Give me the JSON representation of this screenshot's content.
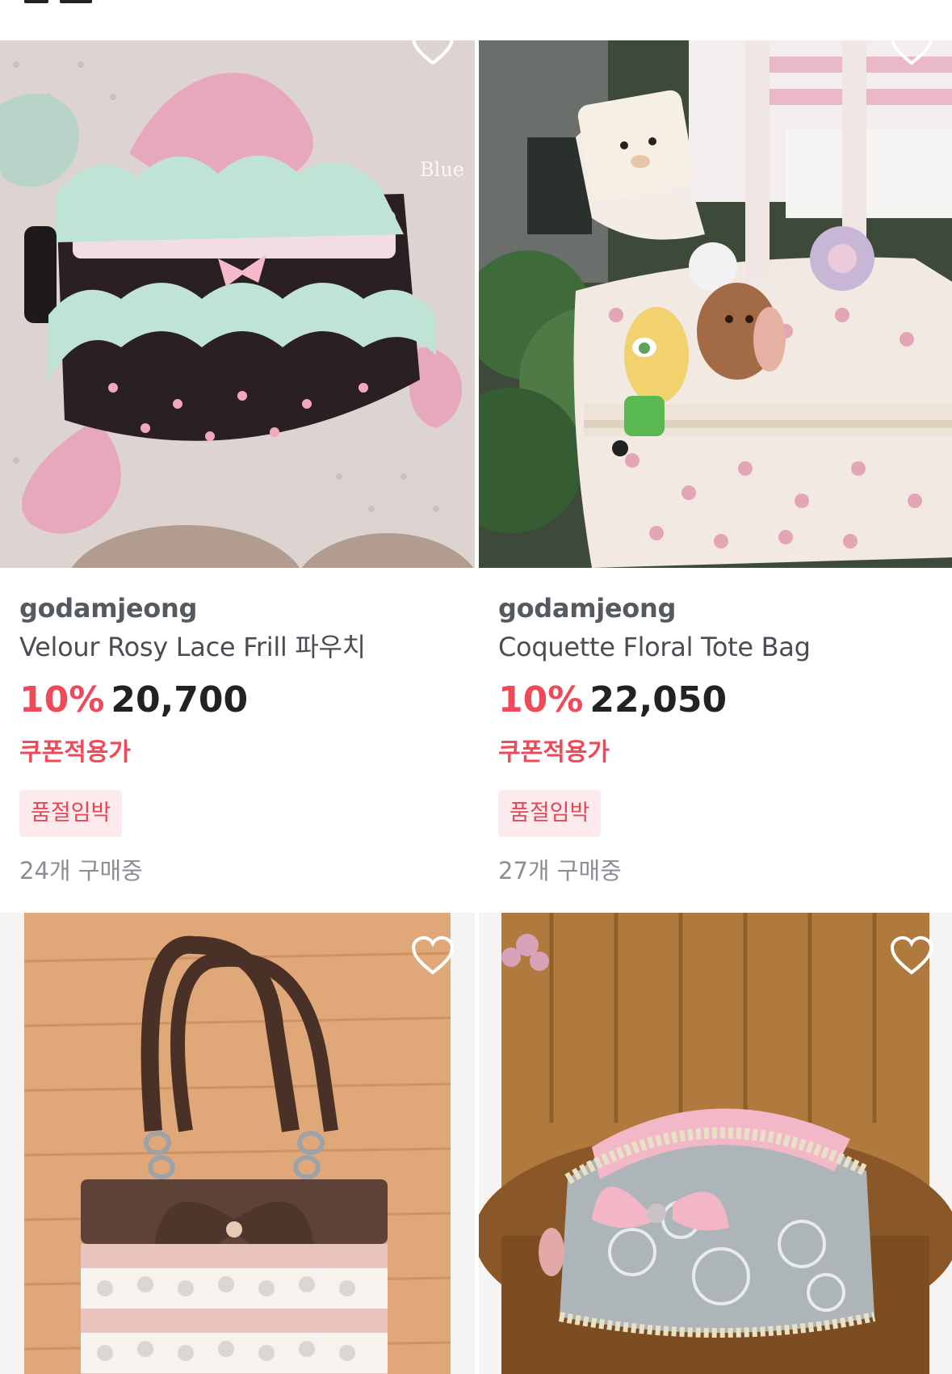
{
  "header": {
    "title": ""
  },
  "products": [
    {
      "brand": "godamjeong",
      "name": "Velour Rosy Lace Frill 파우치",
      "discount": "10%",
      "price": "20,700",
      "coupon": "쿠폰적용가",
      "badge": "품절임박",
      "buyers": "24개 구매중",
      "watermark": "Blue",
      "wishlisted": false
    },
    {
      "brand": "godamjeong",
      "name": "Coquette Floral Tote Bag",
      "discount": "10%",
      "price": "22,050",
      "coupon": "쿠폰적용가",
      "badge": "품절임박",
      "buyers": "27개 구매중",
      "wishlisted": false
    },
    {
      "brand": "",
      "name": "",
      "wishlisted": false
    },
    {
      "brand": "",
      "name": "",
      "wishlisted": false
    }
  ],
  "colors": {
    "accent": "#f04a5a",
    "badge_bg": "#fdeaec",
    "muted": "#8a8e94"
  },
  "icons": {
    "wishlist": "heart-outline-icon"
  }
}
